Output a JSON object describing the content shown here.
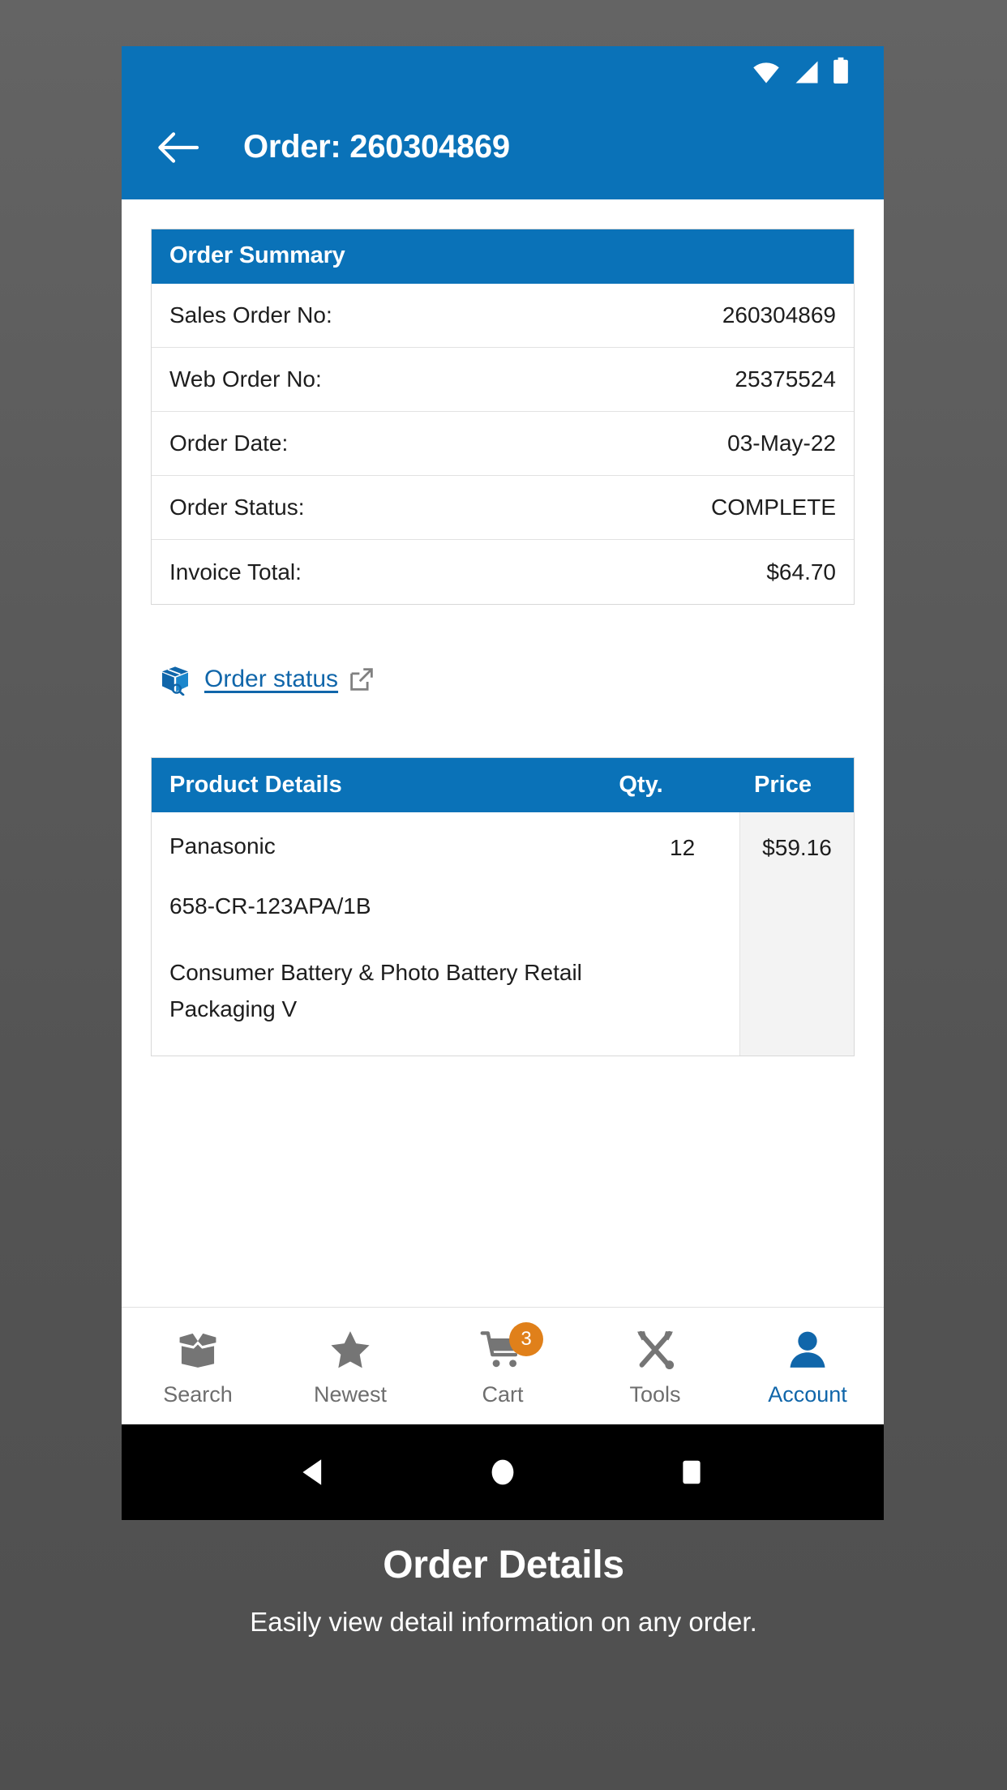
{
  "colors": {
    "brand_blue": "#0a72b8",
    "link_blue": "#1066aa",
    "badge_orange": "#e0801a",
    "page_background": "#545454",
    "icon_gray": "#757575"
  },
  "status_bar": {
    "wifi_icon": "wifi-icon",
    "signal_icon": "cellular-signal-icon",
    "battery_icon": "battery-full-icon"
  },
  "app_bar": {
    "back_icon": "back-arrow-icon",
    "title": "Order: 260304869"
  },
  "order_summary": {
    "header": "Order Summary",
    "rows": [
      {
        "label": "Sales Order No:",
        "value": "260304869"
      },
      {
        "label": "Web Order No:",
        "value": "25375524"
      },
      {
        "label": "Order Date:",
        "value": "03-May-22"
      },
      {
        "label": "Order Status:",
        "value": "COMPLETE"
      },
      {
        "label": "Invoice Total:",
        "value": "$64.70"
      }
    ]
  },
  "order_status_link": {
    "package_icon": "package-search-icon",
    "label": "Order status",
    "external_icon": "external-link-icon"
  },
  "product_table": {
    "columns": {
      "name": "Product Details",
      "qty": "Qty.",
      "price": "Price"
    },
    "rows": [
      {
        "brand": "Panasonic",
        "sku": "658-CR-123APA/1B",
        "description": "Consumer Battery & Photo Battery Retail Packaging V",
        "qty": "12",
        "price": "$59.16"
      }
    ]
  },
  "tab_bar": {
    "tabs": [
      {
        "label": "Search",
        "icon": "open-box-icon",
        "active": false,
        "badge": ""
      },
      {
        "label": "Newest",
        "icon": "star-icon",
        "active": false,
        "badge": ""
      },
      {
        "label": "Cart",
        "icon": "shopping-cart-icon",
        "active": false,
        "badge": "3"
      },
      {
        "label": "Tools",
        "icon": "tools-icon",
        "active": false,
        "badge": ""
      },
      {
        "label": "Account",
        "icon": "person-icon",
        "active": true,
        "badge": ""
      }
    ]
  },
  "android_nav": {
    "back_icon": "android-back-triangle-icon",
    "home_icon": "android-home-circle-icon",
    "recents_icon": "android-recents-square-icon"
  },
  "caption": {
    "title": "Order Details",
    "subtitle": "Easily view detail information on any order."
  }
}
